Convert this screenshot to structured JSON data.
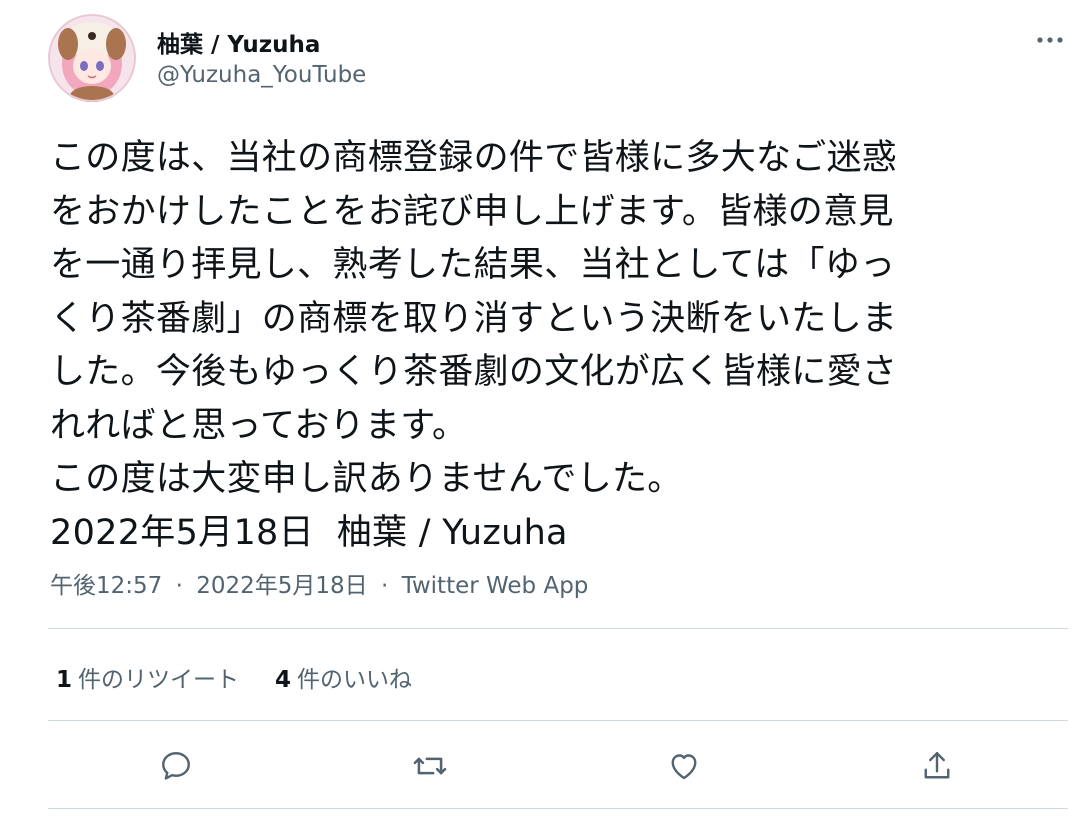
{
  "user": {
    "display_name": "柚葉 / Yuzuha",
    "handle": "@Yuzuha_YouTube",
    "avatar_icon": "profile-avatar"
  },
  "tweet": {
    "lines": [
      "この度は、当社の商標登録の件で皆様に多大なご迷惑",
      "をおかけしたことをお詫び申し上げます。皆様の意見",
      "を一通り拝見し、熟考した結果、当社としては「ゆっ",
      "くり茶番劇」の商標を取り消すという決断をいたしま",
      "した。今後もゆっくり茶番劇の文化が広く皆様に愛さ",
      "れればと思っております。",
      "この度は大変申し訳ありませんでした。",
      "2022年5月18日  柚葉 / Yuzuha"
    ]
  },
  "meta": {
    "time": "午後12:57",
    "separator": "·",
    "date": "2022年5月18日",
    "source": "Twitter Web App"
  },
  "stats": {
    "retweets_count": "1",
    "retweets_label": "件のリツイート",
    "likes_count": "4",
    "likes_label": "件のいいね"
  },
  "actions": {
    "reply_icon": "reply-icon",
    "retweet_icon": "retweet-icon",
    "like_icon": "heart-icon",
    "share_icon": "share-icon",
    "more_icon": "more-icon"
  },
  "colors": {
    "text_primary": "#0f1419",
    "text_secondary": "#536471",
    "divider": "#cfd9de"
  }
}
